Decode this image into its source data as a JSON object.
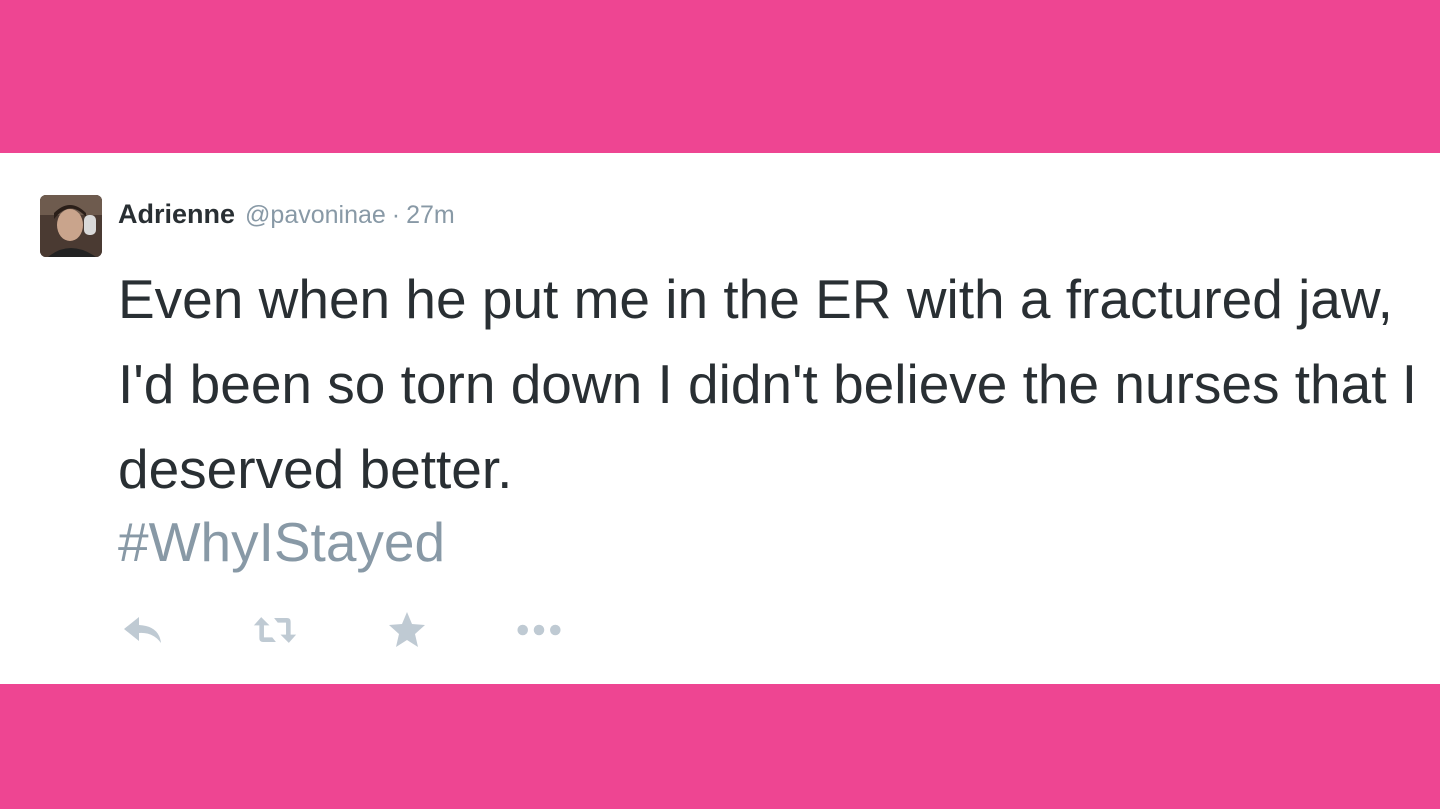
{
  "tweet": {
    "author_name": "Adrienne",
    "handle": "@pavoninae",
    "separator": "·",
    "time": "27m",
    "text": "Even when he put me in the ER with a fractured jaw, I'd been so torn down I didn't believe the nurses that I deserved better.",
    "hashtag": "#WhyIStayed",
    "avatar_icon": "avatar-photo"
  },
  "actions": [
    {
      "icon": "reply-icon"
    },
    {
      "icon": "retweet-icon"
    },
    {
      "icon": "favorite-star-icon"
    },
    {
      "icon": "more-dots-icon"
    }
  ],
  "colors": {
    "background_pink": "#ee4592",
    "card": "#ffffff",
    "text": "#292f33",
    "muted": "#8899a6",
    "icon": "#bfcad3"
  }
}
